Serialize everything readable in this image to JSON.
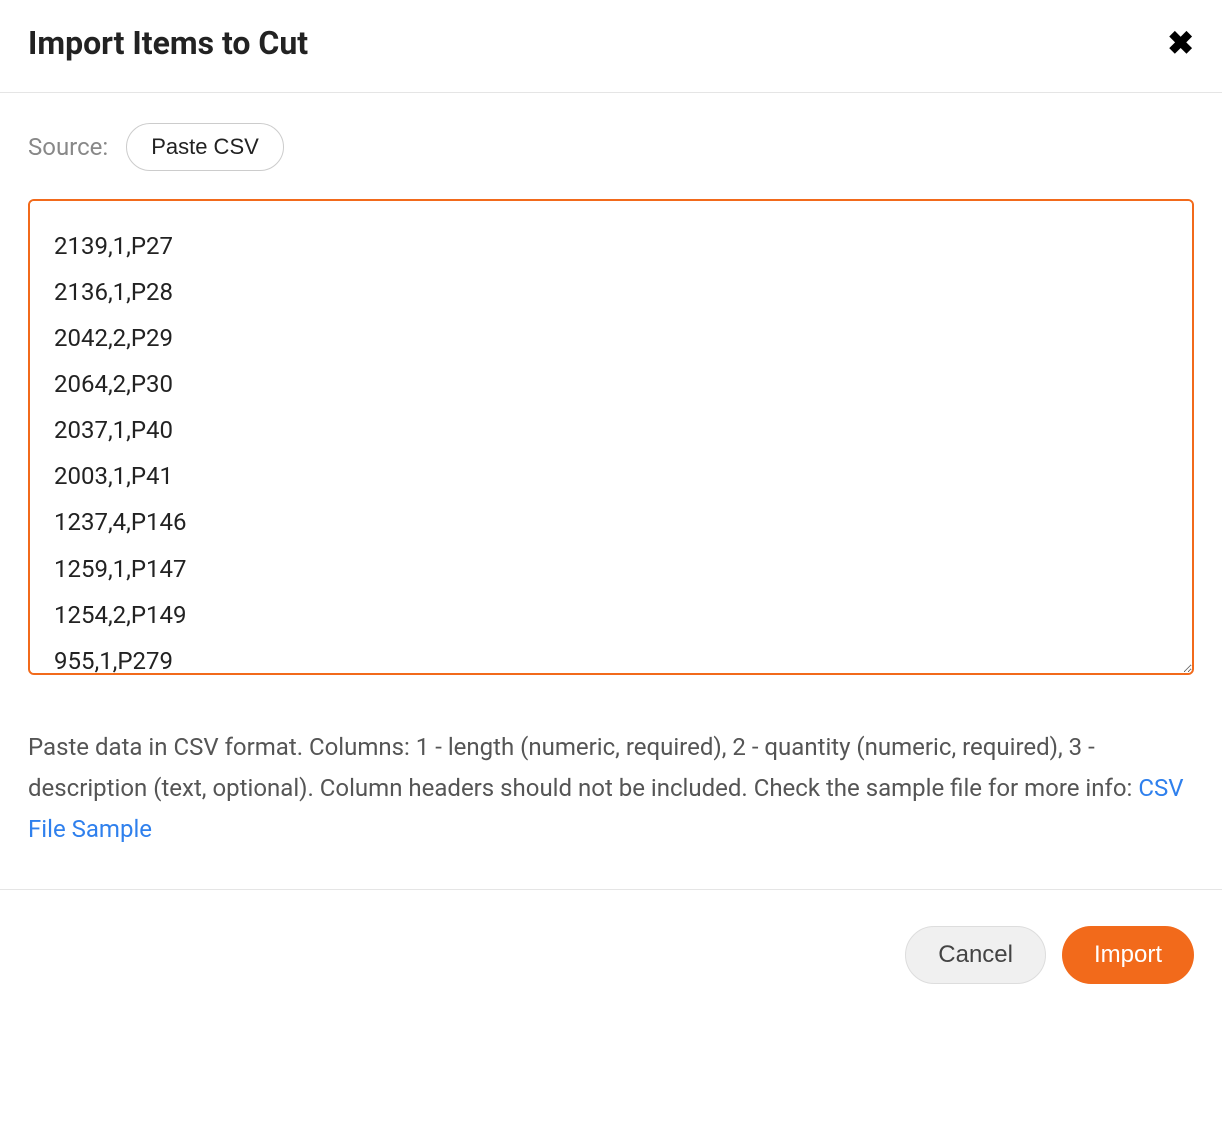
{
  "modal": {
    "title": "Import Items to Cut"
  },
  "source": {
    "label": "Source:",
    "selected": "Paste CSV"
  },
  "textarea": {
    "value": "2139,1,P27\n2136,1,P28\n2042,2,P29\n2064,2,P30\n2037,1,P40\n2003,1,P41\n1237,4,P146\n1259,1,P147\n1254,2,P149\n955,1,P279"
  },
  "help": {
    "text": "Paste data in CSV format. Columns: 1 - length (numeric, required), 2 - quantity (numeric, required), 3 - description (text, optional). Column headers should not be included. Check the sample file for more info: ",
    "link_label": "CSV File Sample"
  },
  "footer": {
    "cancel_label": "Cancel",
    "import_label": "Import"
  }
}
